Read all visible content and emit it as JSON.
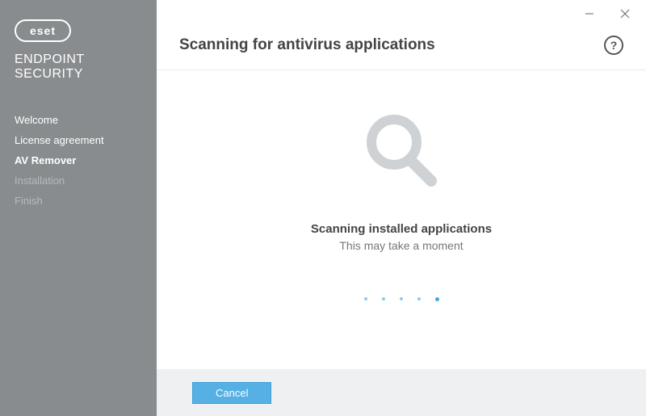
{
  "brand": {
    "name": "eset",
    "line1": "ENDPOINT",
    "line2": "SECURITY"
  },
  "sidebar": {
    "steps": [
      {
        "label": "Welcome",
        "state": "done"
      },
      {
        "label": "License agreement",
        "state": "done"
      },
      {
        "label": "AV Remover",
        "state": "active"
      },
      {
        "label": "Installation",
        "state": "upcoming"
      },
      {
        "label": "Finish",
        "state": "upcoming"
      }
    ]
  },
  "header": {
    "title": "Scanning for antivirus applications"
  },
  "content": {
    "status_primary": "Scanning installed applications",
    "status_secondary": "This may take a moment"
  },
  "footer": {
    "cancel_label": "Cancel"
  }
}
